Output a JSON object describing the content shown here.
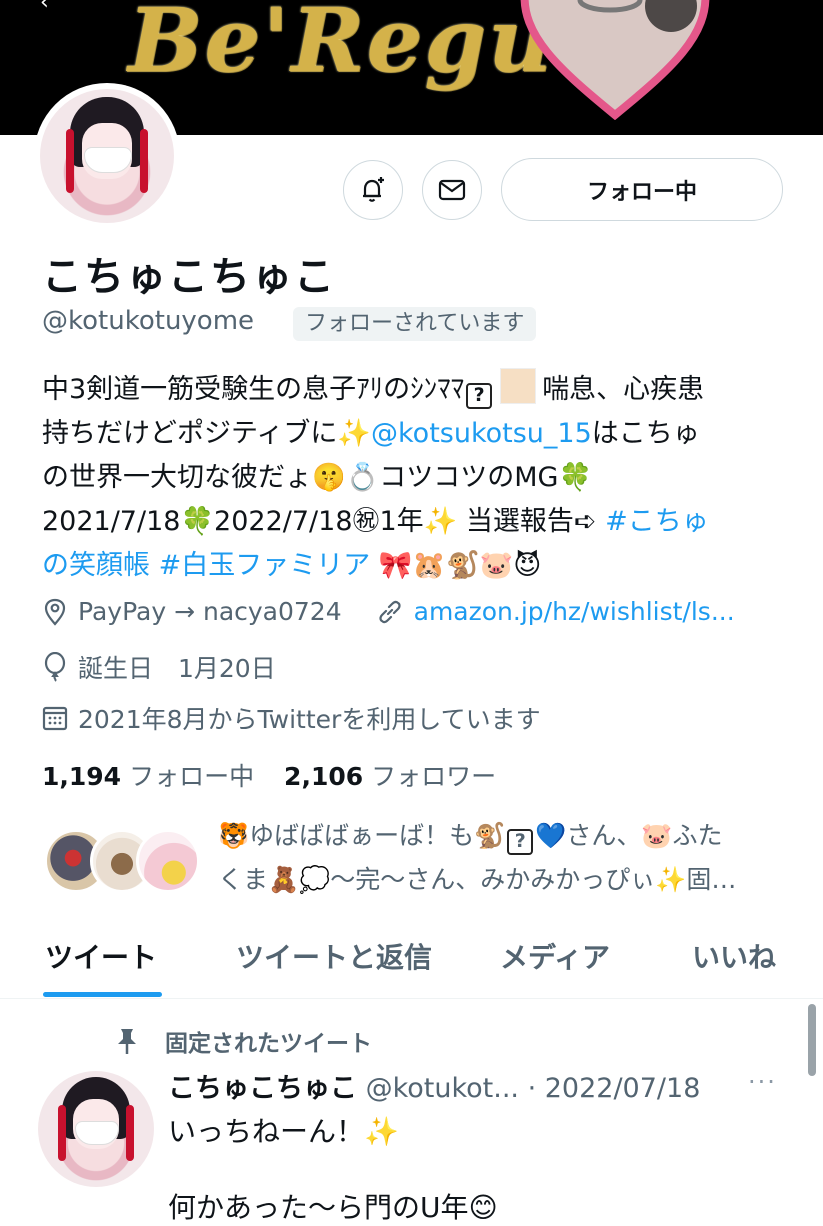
{
  "banner": {
    "text": "Be'Regu"
  },
  "header": {
    "follow_button": "フォロー中"
  },
  "profile": {
    "name": "こちゅこちゅこ",
    "handle": "@kotukotuyome",
    "follows_you": "フォローされています",
    "bio": {
      "line1_a": "中3剣道一筋受験生の息子ｱﾘのｼﾝﾏﾏ",
      "line1_q": "?",
      "line1_b": "喘息、心疾患",
      "line2_a": "持ちだけどポジティブに✨",
      "line2_link": "@kotsukotsu_15",
      "line2_b": "はこちゅ",
      "line3": "の世界一大切な彼だょ🤫💍コツコツのMG🍀",
      "line4_a": "2021/7/18🍀2022/7/18㊗1年✨ 当選報告➪ ",
      "line4_link": "#こちゅ",
      "line5_link": "の笑顔帳 #白玉ファミリア",
      "line5_emoji": " 🎀🐹🐒🐷😈"
    },
    "location": "PayPay → nacya0724",
    "website": "amazon.jp/hz/wishlist/ls...",
    "birthday": "誕生日　1月20日",
    "joined": "2021年8月からTwitterを利用しています",
    "following_count": "1,194",
    "following_label": "フォロー中",
    "followers_count": "2,106",
    "followers_label": "フォロワー",
    "followed_by_line1_a": "🐯ゆばばばぁーば！も🐒",
    "followed_by_q": "?",
    "followed_by_line1_b": "💙さん、🐷ふた",
    "followed_by_line2": "くま🧸💭〜完〜さん、みかみかっぴぃ✨固…"
  },
  "tabs": [
    "ツイート",
    "ツイートと返信",
    "メディア",
    "いいね"
  ],
  "pinned_tweet": {
    "label": "固定されたツイート",
    "name": "こちゅこちゅこ",
    "handle_date": " @kotukot... · 2022/07/18",
    "more": "···",
    "text": "いっちねーん！✨",
    "text2": "何かあった〜ら門のU年😊"
  },
  "colors": {
    "accent": "#1d9bf0",
    "secondary_text": "#536471",
    "border": "#cfd9de"
  }
}
